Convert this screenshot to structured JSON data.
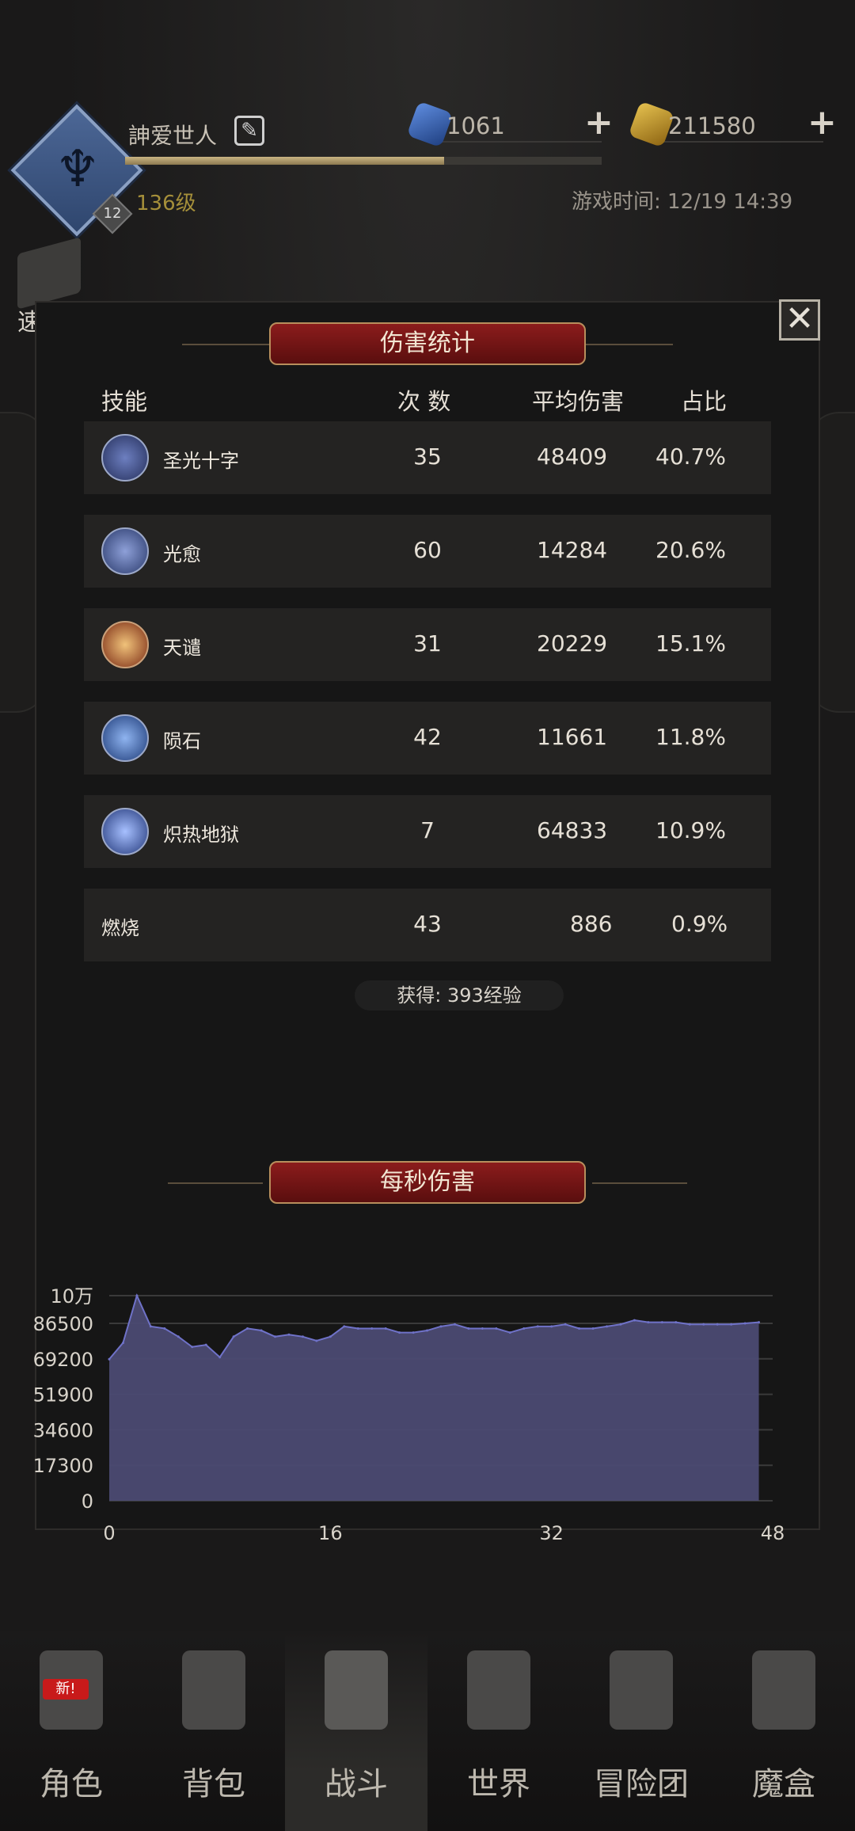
{
  "header": {
    "player_name": "訷爱世人",
    "level": "136级",
    "avatar_level": "12",
    "exp_fraction": 0.67,
    "gems": "1061",
    "gold": "211580",
    "game_time": "游戏时间: 12/19 14:39",
    "quick_battle_label": "速 战"
  },
  "damage_stats": {
    "title": "伤害统计",
    "columns": {
      "skill": "技能",
      "count": "次 数",
      "avg": "平均伤害",
      "pct": "占比"
    },
    "rows": [
      {
        "name": "圣光十字",
        "count": "35",
        "avg": "48409",
        "pct": "40.7%",
        "icon": "holy-cross-icon"
      },
      {
        "name": "光愈",
        "count": "60",
        "avg": "14284",
        "pct": "20.6%",
        "icon": "light-heal-icon"
      },
      {
        "name": "天谴",
        "count": "31",
        "avg": "20229",
        "pct": "15.1%",
        "icon": "divine-wrath-icon"
      },
      {
        "name": "陨石",
        "count": "42",
        "avg": "11661",
        "pct": "11.8%",
        "icon": "meteor-icon"
      },
      {
        "name": "炽热地狱",
        "count": "7",
        "avg": "64833",
        "pct": "10.9%",
        "icon": "inferno-icon"
      },
      {
        "name": "燃烧",
        "count": "43",
        "avg": "886",
        "pct": "0.9%",
        "icon": ""
      }
    ],
    "exp_gained": "获得: 393经验"
  },
  "dps": {
    "title": "每秒伤害"
  },
  "chart_data": {
    "type": "area",
    "x": [
      0,
      1,
      2,
      3,
      4,
      5,
      6,
      7,
      8,
      9,
      10,
      11,
      12,
      13,
      14,
      15,
      16,
      17,
      18,
      19,
      20,
      21,
      22,
      23,
      24,
      25,
      26,
      27,
      28,
      29,
      30,
      31,
      32,
      33,
      34,
      35,
      36,
      37,
      38,
      39,
      40,
      41,
      42,
      43,
      44,
      45,
      46,
      47
    ],
    "values": [
      69000,
      77000,
      100000,
      85000,
      84000,
      80000,
      75000,
      76000,
      70000,
      80000,
      84000,
      83000,
      80000,
      81000,
      80000,
      78000,
      80000,
      85000,
      84000,
      84000,
      84000,
      82000,
      82000,
      83000,
      85000,
      86000,
      84000,
      84000,
      84000,
      82000,
      84000,
      85000,
      85000,
      86000,
      84000,
      84000,
      85000,
      86000,
      88000,
      87000,
      87000,
      87000,
      86000,
      86000,
      86000,
      86000,
      86500,
      87000
    ],
    "y_ticks": [
      "10万",
      "86500",
      "69200",
      "51900",
      "34600",
      "17300",
      "0"
    ],
    "y_tick_values": [
      100000,
      86500,
      69200,
      51900,
      34600,
      17300,
      0
    ],
    "x_ticks": [
      "0",
      "16",
      "32",
      "48"
    ],
    "x_tick_values": [
      0,
      16,
      32,
      48
    ],
    "ylim": [
      0,
      100000
    ],
    "xlim": [
      0,
      48
    ],
    "grid": true,
    "fill_color": "#4b4a72",
    "line_color": "#6f72c8"
  },
  "nav": {
    "items": [
      {
        "label": "角色",
        "badge": "新!"
      },
      {
        "label": "背包"
      },
      {
        "label": "战斗"
      },
      {
        "label": "世界"
      },
      {
        "label": "冒险团"
      },
      {
        "label": "魔盒"
      }
    ],
    "active_index": 2
  },
  "colors": {
    "gem": "#2e5fb0",
    "gold": "#c99a2a",
    "banner": "#7a1515",
    "level": "#a58f3a"
  }
}
